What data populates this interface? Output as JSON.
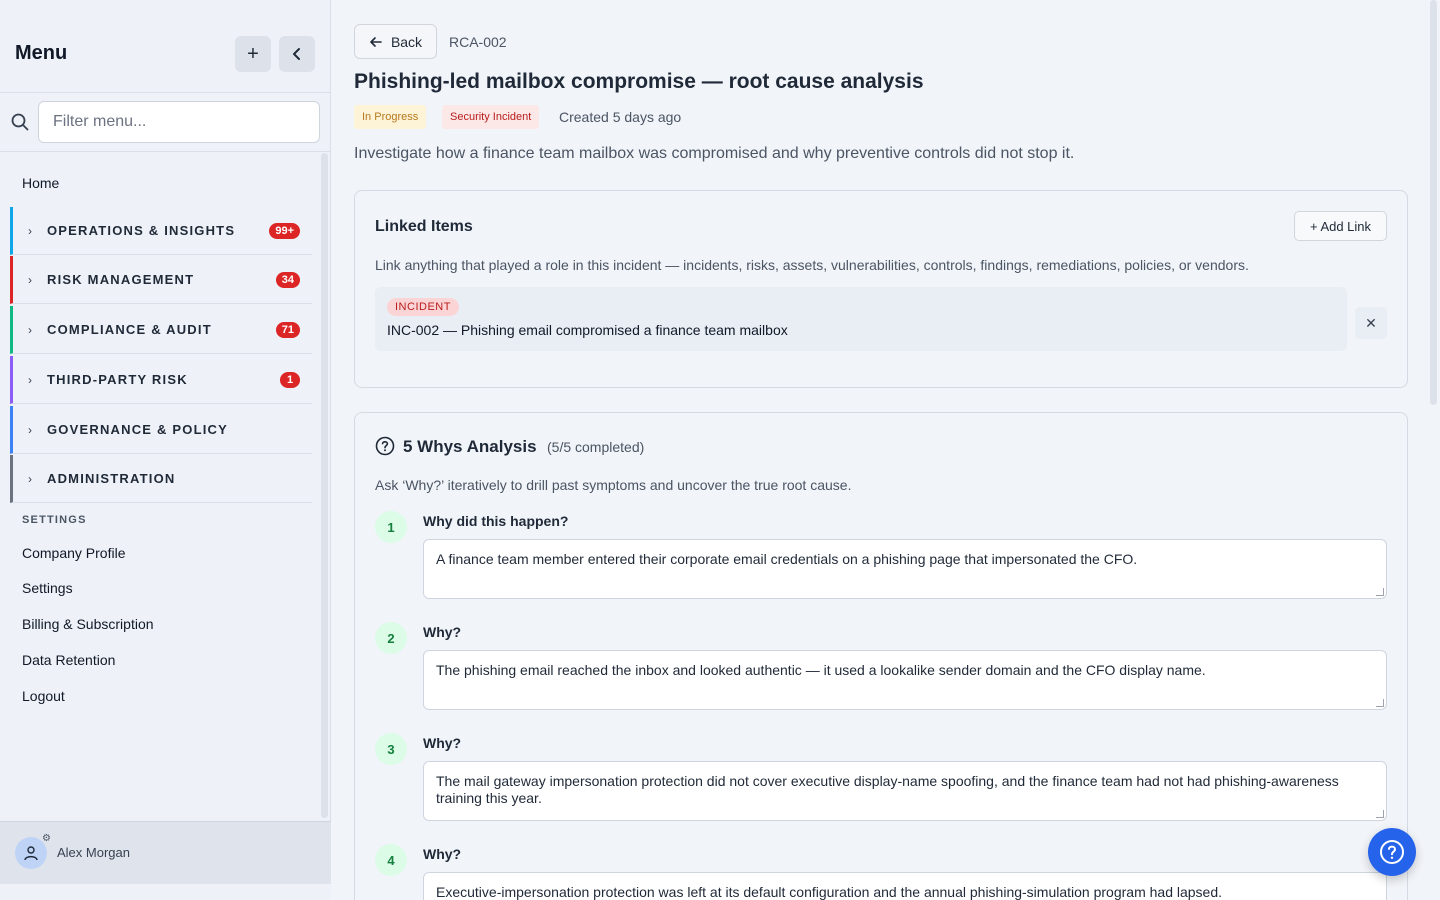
{
  "sidebar": {
    "title": "Menu",
    "filter_placeholder": "Filter menu...",
    "home": "Home",
    "groups": [
      {
        "label": "OPERATIONS & INSIGHTS",
        "badge": "99+",
        "color": "#0ea5e9"
      },
      {
        "label": "RISK MANAGEMENT",
        "badge": "34",
        "color": "#dc2626"
      },
      {
        "label": "COMPLIANCE & AUDIT",
        "badge": "71",
        "color": "#10b981"
      },
      {
        "label": "THIRD-PARTY RISK",
        "badge": "1",
        "color": "#8b5cf6"
      },
      {
        "label": "GOVERNANCE & POLICY",
        "badge": "",
        "color": "#3b82f6"
      },
      {
        "label": "ADMINISTRATION",
        "badge": "",
        "color": "#6b7280"
      }
    ],
    "settings_section": "SETTINGS",
    "links": [
      "Company Profile",
      "Settings",
      "Billing & Subscription",
      "Data Retention",
      "Logout"
    ],
    "user_name": "Alex Morgan"
  },
  "header": {
    "back_label": "Back",
    "rca_id": "RCA-002",
    "title": "Phishing-led mailbox compromise — root cause analysis",
    "status_badge": "In Progress",
    "type_badge": "Security Incident",
    "created": "Created 5 days ago",
    "description": "Investigate how a finance team mailbox was compromised and why preventive controls did not stop it."
  },
  "linked_items": {
    "title": "Linked Items",
    "add_label": "+ Add Link",
    "subtitle": "Link anything that played a role in this incident — incidents, risks, assets, vulnerabilities, controls, findings, remediations, policies, or vendors.",
    "items": [
      {
        "type": "INCIDENT",
        "text": "INC-002 — Phishing email compromised a finance team mailbox"
      }
    ]
  },
  "whys": {
    "title": "5 Whys Analysis",
    "count": "(5/5 completed)",
    "subtitle": "Ask ‘Why?’ iteratively to drill past symptoms and uncover the true root cause.",
    "items": [
      {
        "num": "1",
        "question": "Why did this happen?",
        "answer": "A finance team member entered their corporate email credentials on a phishing page that impersonated the CFO."
      },
      {
        "num": "2",
        "question": "Why?",
        "answer": "The phishing email reached the inbox and looked authentic — it used a lookalike sender domain and the CFO display name."
      },
      {
        "num": "3",
        "question": "Why?",
        "answer": "The mail gateway impersonation protection did not cover executive display-name spoofing, and the finance team had not had phishing-awareness training this year."
      },
      {
        "num": "4",
        "question": "Why?",
        "answer": "Executive-impersonation protection was left at its default configuration and the annual phishing-simulation program had lapsed."
      }
    ]
  },
  "colors": {
    "accent": "#2563eb",
    "success": "#15803d",
    "danger": "#dc2626"
  }
}
